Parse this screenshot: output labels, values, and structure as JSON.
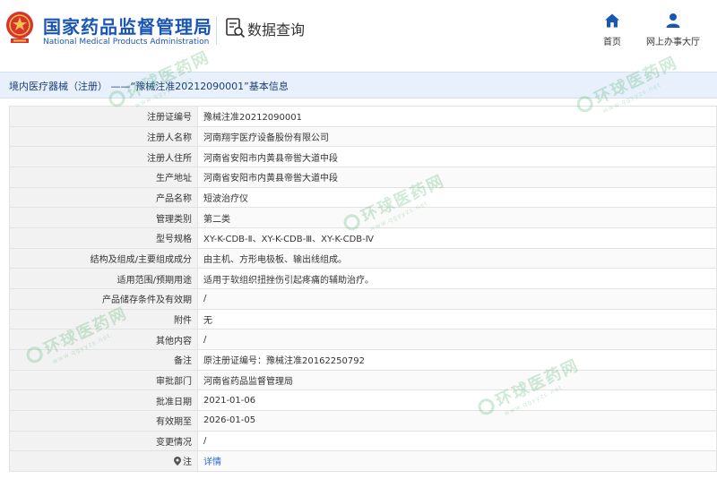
{
  "header": {
    "brand_cn": "国家药品监督管理局",
    "brand_en": "National Medical Products Administration",
    "query_title": "数据查询",
    "nav": {
      "home": "首页",
      "service": "网上办事大厅"
    }
  },
  "band": {
    "text": "境内医疗器械（注册） ——“豫械注准20212090001”基本信息"
  },
  "watermark": {
    "cn": "环球医药网",
    "en": "www.qgyyzs.net"
  },
  "colors": {
    "brand_blue": "#1a56b4",
    "band_bg": "#e8f0fb",
    "link": "#2b6bd1",
    "watermark": "#29a24a"
  },
  "rows": [
    {
      "label": "注册证编号",
      "value": "豫械注准20212090001"
    },
    {
      "label": "注册人名称",
      "value": "河南翔宇医疗设备股份有限公司"
    },
    {
      "label": "注册人住所",
      "value": "河南省安阳市内黄县帝喾大道中段"
    },
    {
      "label": "生产地址",
      "value": "河南省安阳市内黄县帝喾大道中段"
    },
    {
      "label": "产品名称",
      "value": "短波治疗仪"
    },
    {
      "label": "管理类别",
      "value": "第二类"
    },
    {
      "label": "型号规格",
      "value": "XY-K-CDB-Ⅱ、XY-K-CDB-Ⅲ、XY-K-CDB-Ⅳ"
    },
    {
      "label": "结构及组成/主要组成成分",
      "value": "由主机、方形电极板、输出线组成。"
    },
    {
      "label": "适用范围/预期用途",
      "value": "适用于软组织扭挫伤引起疼痛的辅助治疗。"
    },
    {
      "label": "产品储存条件及有效期",
      "value": "/"
    },
    {
      "label": "附件",
      "value": "无"
    },
    {
      "label": "其他内容",
      "value": "/"
    },
    {
      "label": "备注",
      "value": "原注册证编号：豫械注准20162250792"
    },
    {
      "label": "审批部门",
      "value": "河南省药品监督管理局"
    },
    {
      "label": "批准日期",
      "value": "2021-01-06"
    },
    {
      "label": "有效期至",
      "value": "2026-01-05"
    },
    {
      "label": "变更情况",
      "value": "/"
    },
    {
      "label": "注",
      "value": "详情"
    }
  ]
}
